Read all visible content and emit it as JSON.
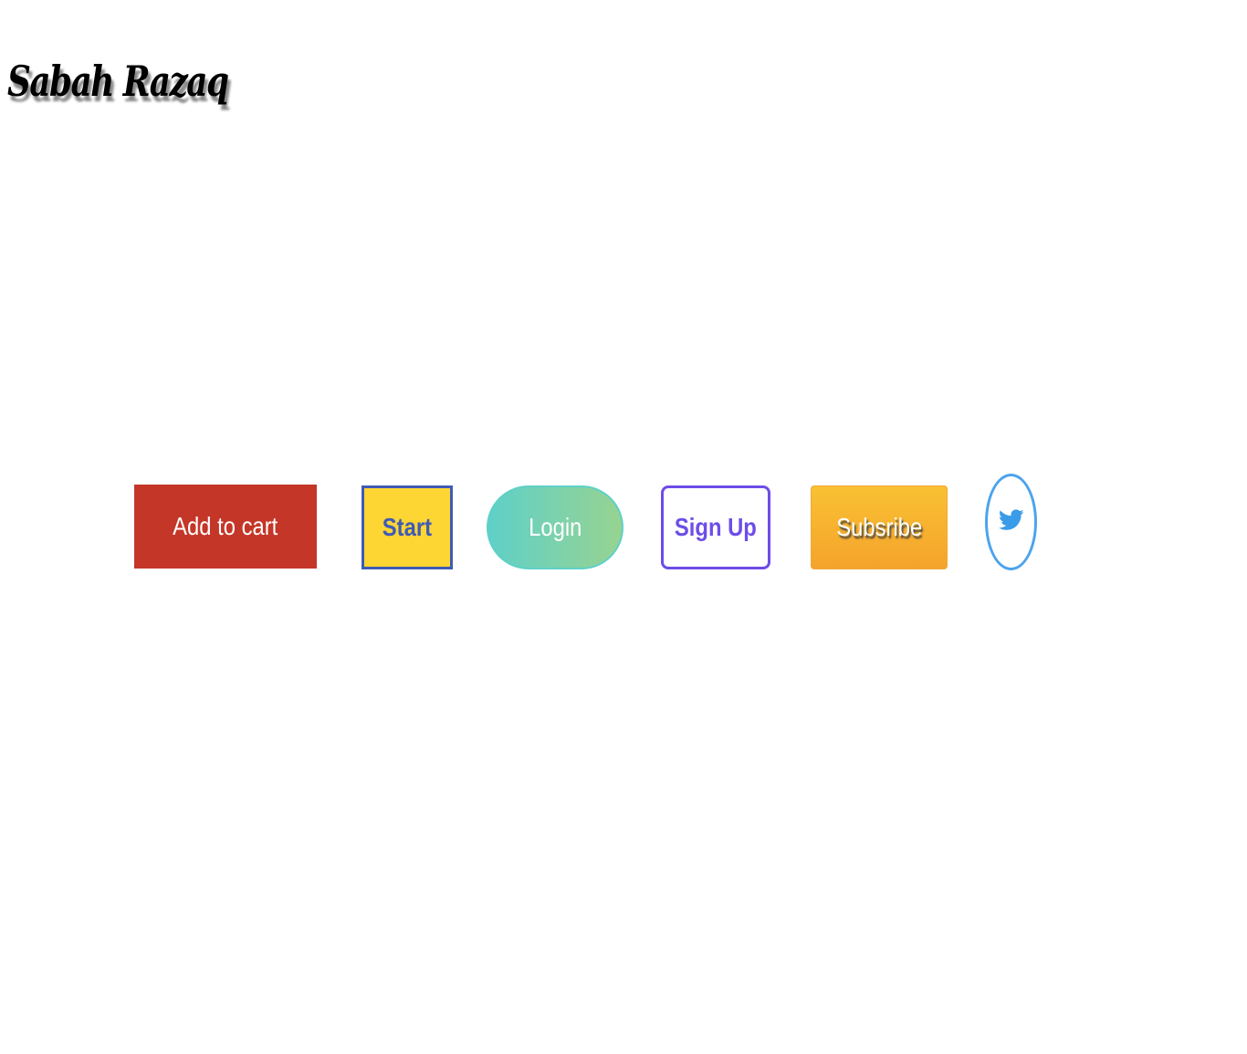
{
  "header": {
    "title": "Sabah Razaq"
  },
  "buttons": {
    "add_to_cart": "Add to cart",
    "start": "Start",
    "login": "Login",
    "sign_up": "Sign Up",
    "subscribe": "Subsribe",
    "twitter_icon": "twitter-icon"
  },
  "colors": {
    "add_to_cart_bg": "#c43628",
    "start_bg": "#fdd633",
    "start_border": "#3f5bb5",
    "login_gradient_start": "#5fd0c8",
    "login_gradient_end": "#97d391",
    "sign_up_accent": "#6d4de8",
    "subscribe_bg": "#f5a32b",
    "twitter_blue": "#4da3ed"
  }
}
